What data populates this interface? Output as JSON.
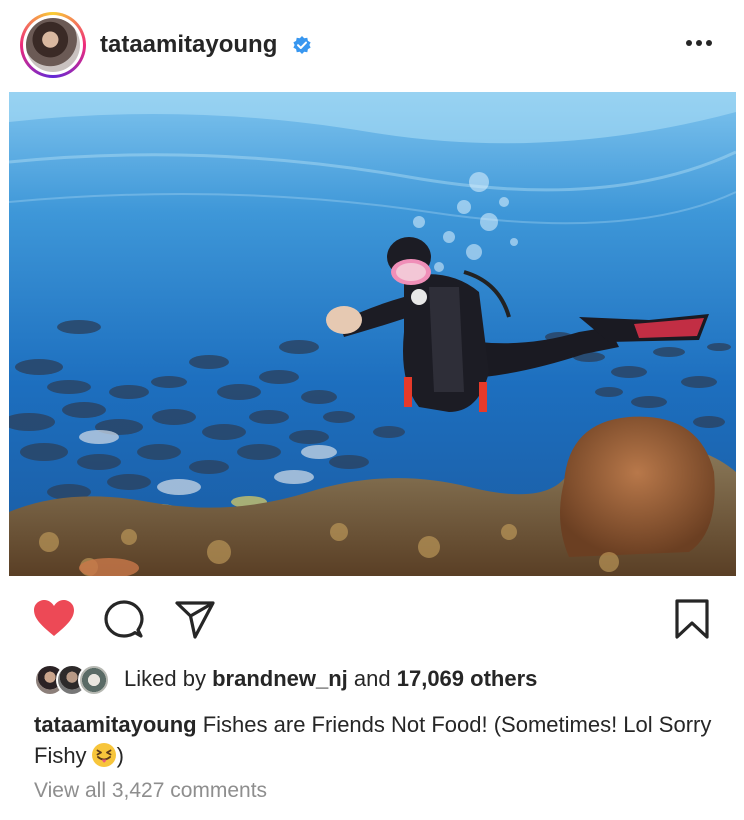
{
  "post": {
    "username": "tataamitayoung",
    "verified": true
  },
  "photo": {
    "alt": "underwater scuba diver photo"
  },
  "actions": {
    "like_icon": "heart-filled-icon",
    "comment_icon": "comment-icon",
    "share_icon": "share-icon",
    "save_icon": "bookmark-icon",
    "like_color": "#ed4956"
  },
  "likes": {
    "prefix": "Liked by",
    "user": "brandnew_nj",
    "middle": "and",
    "others": "17,069 others"
  },
  "caption": {
    "username": "tataamitayoung",
    "text_before_emoji": "Fishes are Friends Not Food! (Sometimes! Lol Sorry Fishy",
    "emoji_icon": "squinting-tongue-emoji-icon",
    "text_after_emoji": ")"
  },
  "comments": {
    "view_all": "View all 3,427 comments"
  },
  "colors": {
    "text": "#262626",
    "muted": "#8e8e8e",
    "verified": "#3897f0"
  }
}
